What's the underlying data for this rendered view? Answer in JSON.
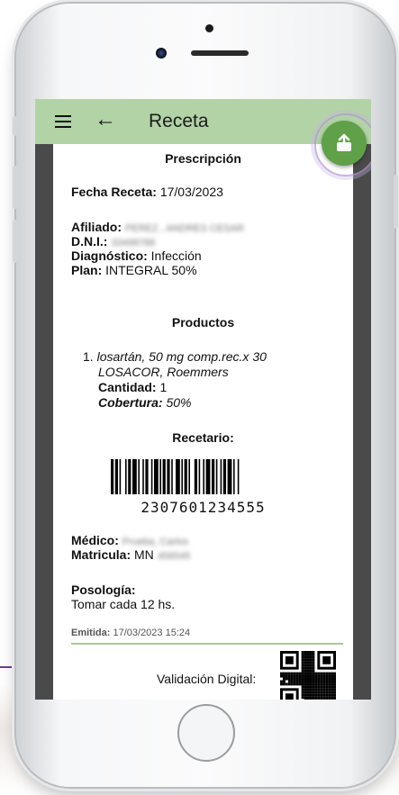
{
  "appbar": {
    "title": "Receta",
    "menu_icon": "menu-icon",
    "back_icon": "back-arrow-icon"
  },
  "fab": {
    "icon": "share-icon",
    "color": "#5fa049"
  },
  "prescription": {
    "heading": "Prescripción",
    "fecha_label": "Fecha Receta:",
    "fecha_value": "17/03/2023",
    "afiliado_label": "Afiliado:",
    "afiliado_value": "PEREZ , ANDRES CESAR",
    "dni_label": "D.N.I.:",
    "dni_value": "33498788",
    "diagnostico_label": "Diagnóstico:",
    "diagnostico_value": "Infección",
    "plan_label": "Plan:",
    "plan_value": "INTEGRAL 50%"
  },
  "products": {
    "heading": "Productos",
    "items": [
      {
        "index": "1.",
        "name": "losartán, 50 mg comp.rec.x 30",
        "brand": "LOSACOR, Roemmers",
        "cantidad_label": "Cantidad:",
        "cantidad_value": "1",
        "cobertura_label": "Cobertura:",
        "cobertura_value": "50%"
      }
    ]
  },
  "recetario": {
    "heading": "Recetario:",
    "barcode_number": "2307601234555"
  },
  "medico": {
    "medico_label": "Médico:",
    "medico_value": "Prueba, Carlos",
    "matricula_label": "Matricula:",
    "matricula_prefix": "MN",
    "matricula_value": "456545"
  },
  "posologia": {
    "label": "Posología:",
    "value": "Tomar cada 12 hs."
  },
  "footer": {
    "emitida_label": "Emitida:",
    "emitida_value": "17/03/2023 15:24",
    "validacion_label": "Validación Digital:"
  },
  "colors": {
    "appbar": "#b2d3a6",
    "accent": "#5fa049",
    "divider": "#a7c99a"
  }
}
